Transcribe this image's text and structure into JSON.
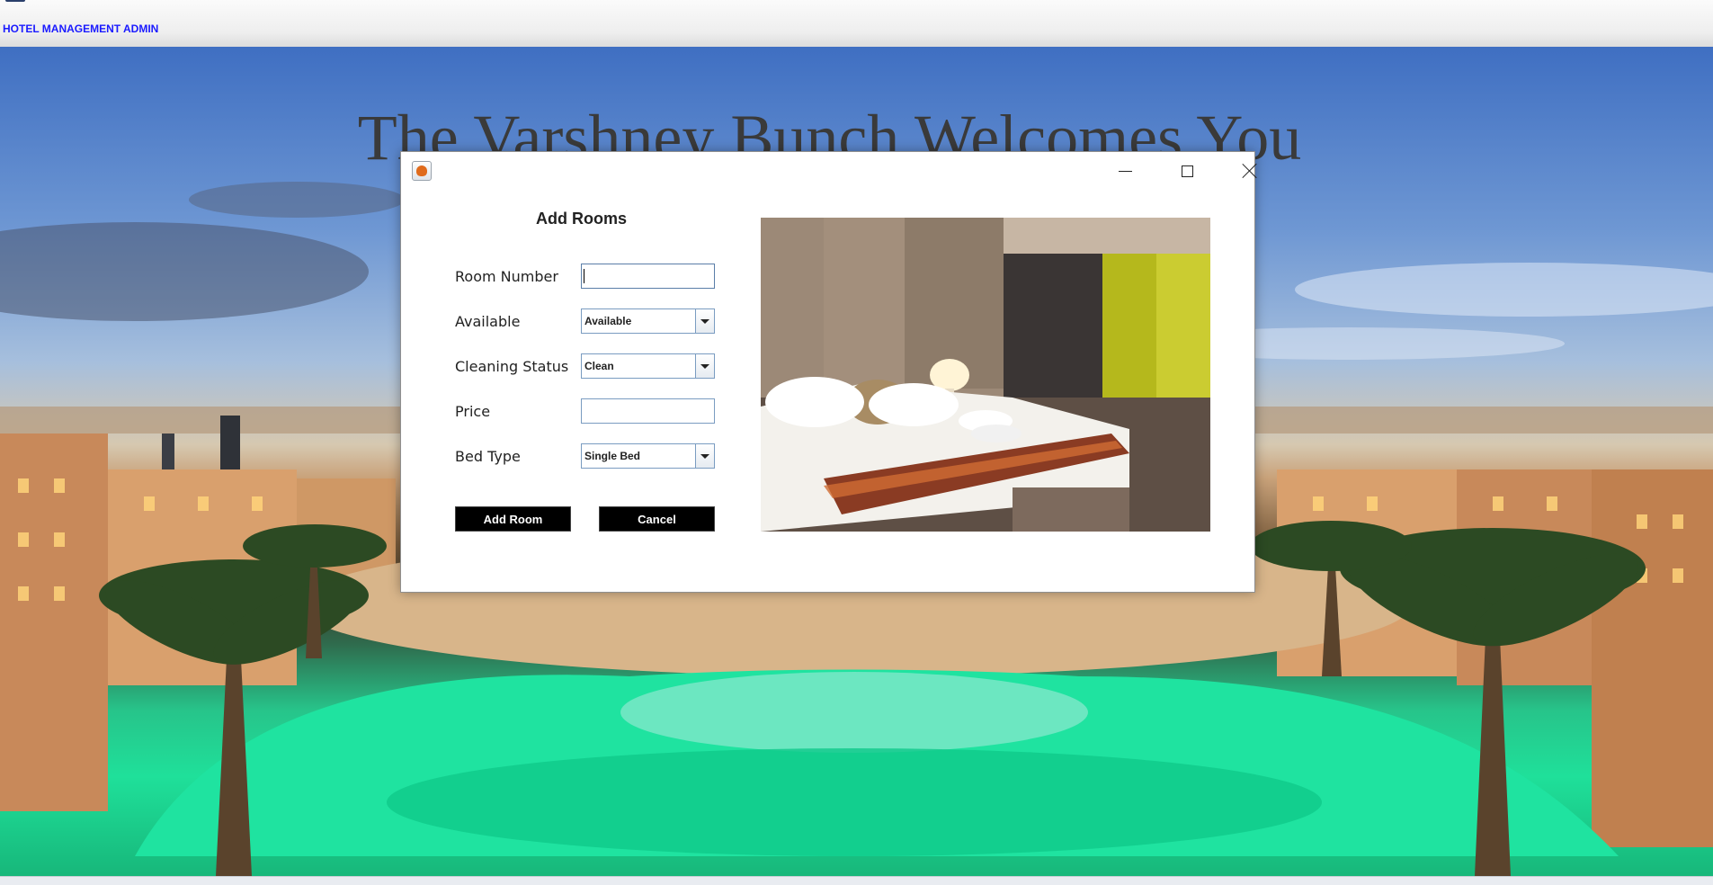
{
  "menu": {
    "items": [
      "HOTEL MANAGEMENT",
      "ADMIN"
    ]
  },
  "background": {
    "welcome_text": "The Varshney Bunch Welcomes You"
  },
  "dialog": {
    "title_icon": "java-coffee-cup-icon",
    "window_controls": [
      "minimize-icon",
      "maximize-icon",
      "close-icon"
    ],
    "form_title": "Add Rooms",
    "fields": {
      "room_number": {
        "label": "Room Number",
        "value": ""
      },
      "available": {
        "label": "Available",
        "selected": "Available"
      },
      "cleaning_status": {
        "label": "Cleaning Status",
        "selected": "Clean"
      },
      "price": {
        "label": "Price",
        "value": ""
      },
      "bed_type": {
        "label": "Bed Type",
        "selected": "Single Bed"
      }
    },
    "buttons": {
      "add_room": "Add Room",
      "cancel": "Cancel"
    },
    "image": "hotel-bedroom-photo"
  },
  "colors": {
    "menu_text": "#1a1aff",
    "button_bg": "#000000",
    "button_text": "#ffffff",
    "field_border": "#7a9cc1"
  }
}
